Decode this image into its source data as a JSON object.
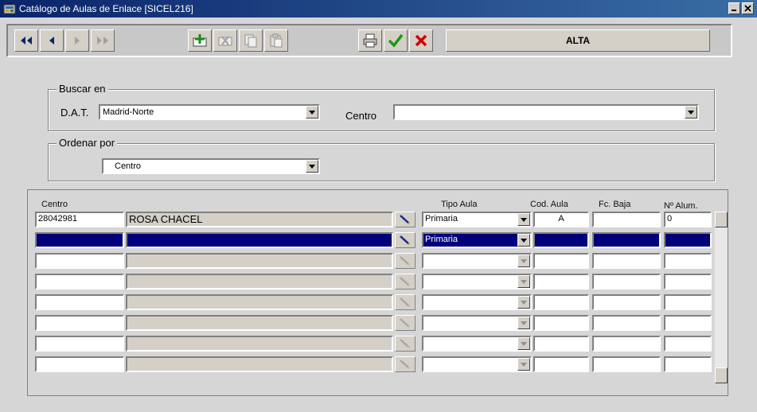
{
  "window": {
    "title": "Catálogo de Aulas de Enlace [SICEL216]"
  },
  "toolbar": {
    "mode": "ALTA"
  },
  "search": {
    "legend": "Buscar en",
    "dat_label": "D.A.T.",
    "dat_value": "Madrid-Norte",
    "centro_label": "Centro",
    "centro_value": ""
  },
  "order": {
    "legend": "Ordenar por",
    "value": "Centro"
  },
  "grid": {
    "headers": {
      "centro": "Centro",
      "tipo": "Tipo Aula",
      "cod": "Cod. Aula",
      "baja": "Fc. Baja",
      "alum": "Nº Alum."
    },
    "rows": [
      {
        "code": "28042981",
        "name": "ROSA CHACEL",
        "tipo": "Primaria",
        "cod": "A",
        "baja": "",
        "alum": "0"
      },
      {
        "code": "",
        "name": "",
        "tipo": "Primaria",
        "cod": "",
        "baja": "",
        "alum": ""
      },
      {
        "code": "",
        "name": "",
        "tipo": "",
        "cod": "",
        "baja": "",
        "alum": ""
      },
      {
        "code": "",
        "name": "",
        "tipo": "",
        "cod": "",
        "baja": "",
        "alum": ""
      },
      {
        "code": "",
        "name": "",
        "tipo": "",
        "cod": "",
        "baja": "",
        "alum": ""
      },
      {
        "code": "",
        "name": "",
        "tipo": "",
        "cod": "",
        "baja": "",
        "alum": ""
      },
      {
        "code": "",
        "name": "",
        "tipo": "",
        "cod": "",
        "baja": "",
        "alum": ""
      },
      {
        "code": "",
        "name": "",
        "tipo": "",
        "cod": "",
        "baja": "",
        "alum": ""
      }
    ]
  },
  "icons": {
    "title": "app-window-icon",
    "first": "first-record-icon",
    "prev": "previous-record-icon",
    "next": "next-record-icon",
    "last": "last-record-icon",
    "insert": "insert-record-icon",
    "delete": "delete-record-icon",
    "copy": "copy-icon",
    "paste": "paste-icon",
    "print": "printer-icon",
    "accept": "checkmark-icon",
    "cancel": "cancel-x-icon"
  },
  "colors": {
    "title_bar": "#0a246a",
    "selected_row": "#00007b",
    "accept": "#1a9a1a",
    "cancel": "#d00000",
    "insert": "#1a8a1a"
  }
}
